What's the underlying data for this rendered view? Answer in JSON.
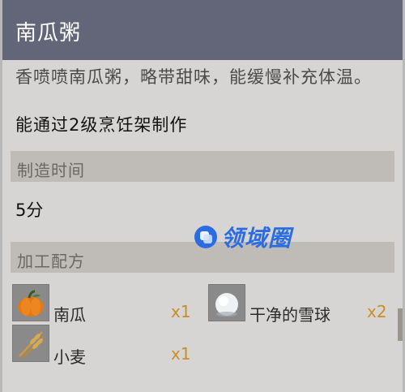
{
  "item": {
    "title": "南瓜粥",
    "description": "香喷喷南瓜粥，略带甜味，能缓慢补充体温。",
    "requirement": "能通过2级烹饪架制作"
  },
  "craft_time": {
    "label": "制造时间",
    "value": "5分"
  },
  "recipe": {
    "label": "加工配方",
    "ingredients": [
      {
        "name": "南瓜",
        "qty": "x1",
        "icon": "pumpkin-icon"
      },
      {
        "name": "干净的雪球",
        "qty": "x2",
        "icon": "snowball-icon"
      },
      {
        "name": "小麦",
        "qty": "x1",
        "icon": "wheat-icon"
      }
    ]
  },
  "watermark": {
    "text": "领域圈"
  },
  "colors": {
    "title_bar": "#636678",
    "panel": "#d7d5d4",
    "section": "#bfbbb7",
    "quantity": "#c98f24",
    "watermark": "#2b6ce0"
  }
}
